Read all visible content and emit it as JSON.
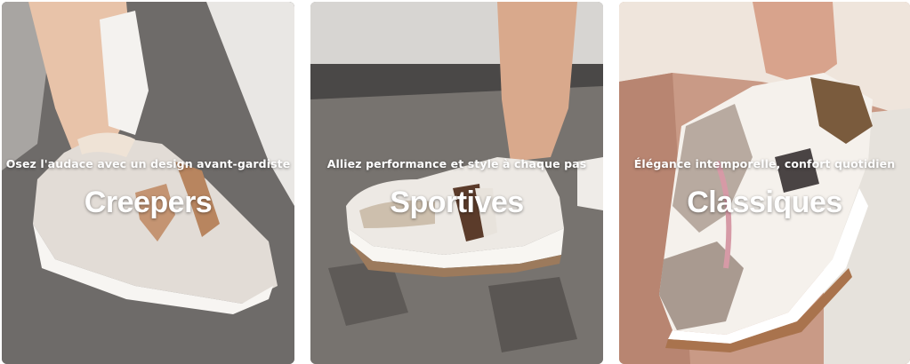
{
  "categories": [
    {
      "tagline": "Osez l'audace avec un design avant-gardiste",
      "title": "Creepers"
    },
    {
      "tagline": "Alliez performance et style à chaque pas",
      "title": "Sportives"
    },
    {
      "tagline": "Élégance intemporelle, confort quotidien",
      "title": "Classiques"
    }
  ]
}
